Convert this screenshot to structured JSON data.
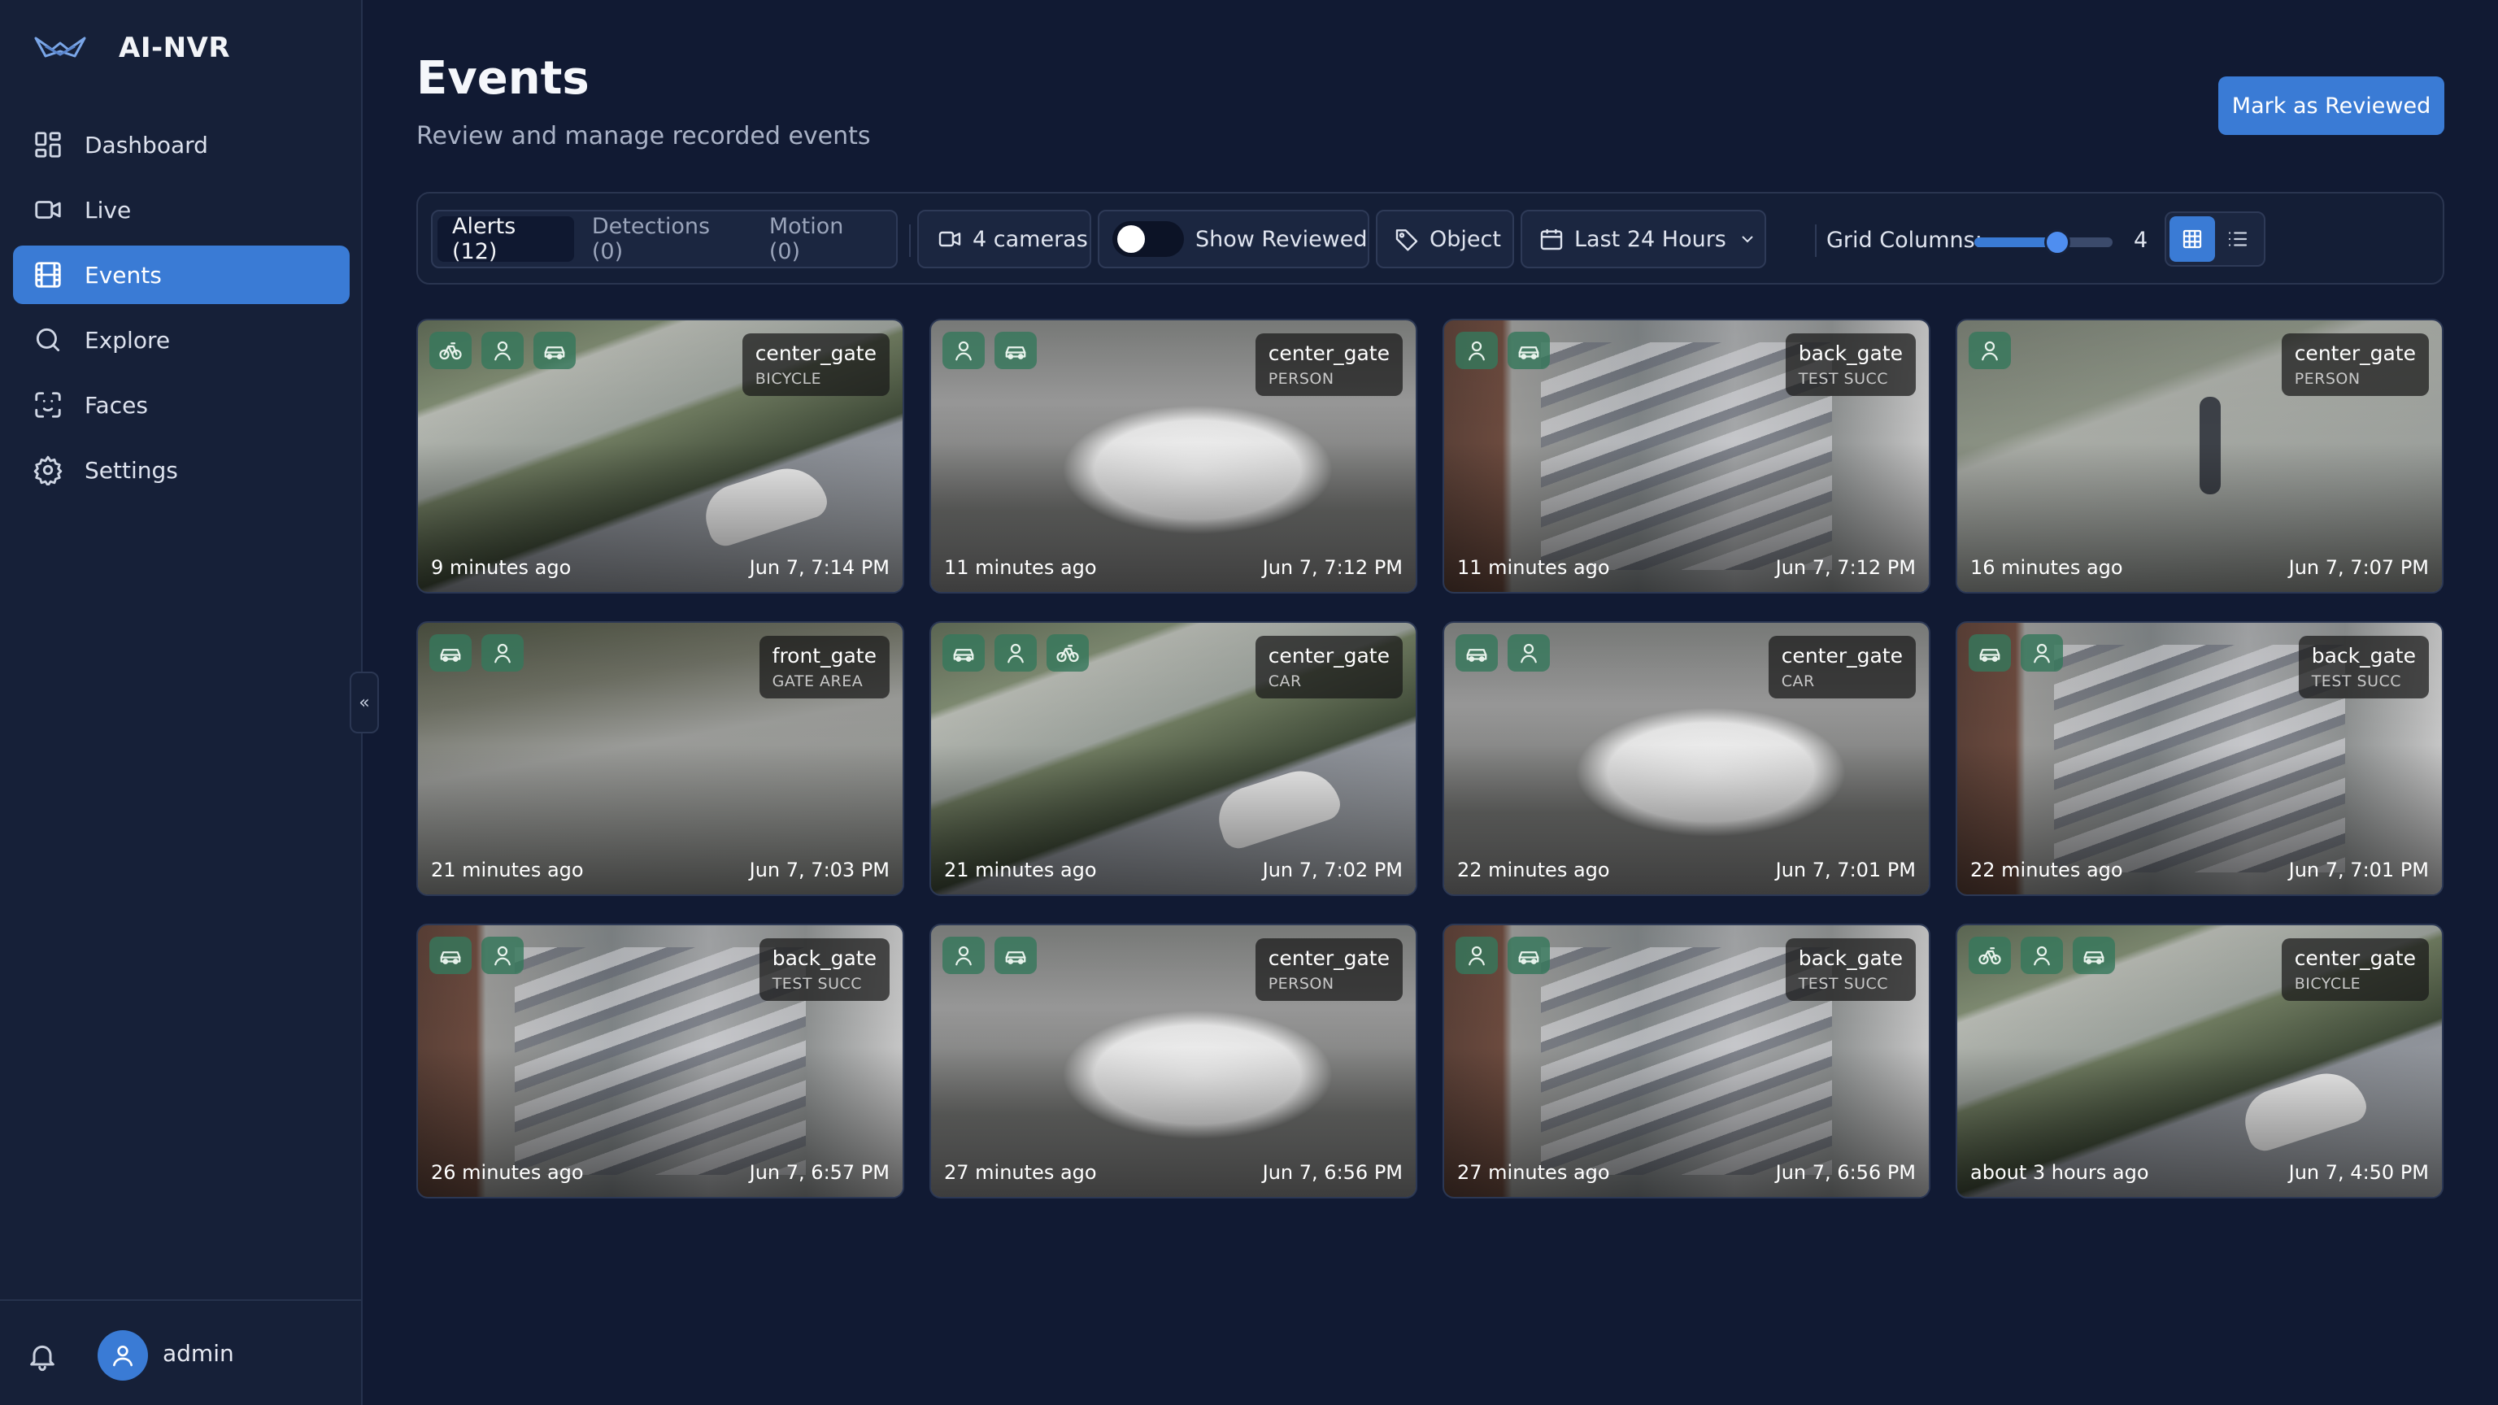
{
  "app": {
    "name": "AI-NVR"
  },
  "nav": [
    {
      "id": "dashboard",
      "label": "Dashboard",
      "icon": "dashboard-icon",
      "active": false
    },
    {
      "id": "live",
      "label": "Live",
      "icon": "video-icon",
      "active": false
    },
    {
      "id": "events",
      "label": "Events",
      "icon": "film-icon",
      "active": true
    },
    {
      "id": "explore",
      "label": "Explore",
      "icon": "search-icon",
      "active": false
    },
    {
      "id": "faces",
      "label": "Faces",
      "icon": "face-scan-icon",
      "active": false
    },
    {
      "id": "settings",
      "label": "Settings",
      "icon": "gear-icon",
      "active": false
    }
  ],
  "user": {
    "name": "admin"
  },
  "page": {
    "title": "Events",
    "subtitle": "Review and manage recorded events",
    "mark_reviewed_label": "Mark as Reviewed"
  },
  "toolbar": {
    "tabs": [
      {
        "label": "Alerts (12)",
        "active": true
      },
      {
        "label": "Detections (0)",
        "active": false
      },
      {
        "label": "Motion (0)",
        "active": false
      }
    ],
    "cameras_label": "4 cameras",
    "show_reviewed_label": "Show Reviewed",
    "show_reviewed_on": false,
    "object_label": "Object",
    "time_range_label": "Last 24 Hours",
    "grid_columns_label": "Grid Columns:",
    "grid_columns_value": "4",
    "grid_columns_min": 1,
    "grid_columns_max": 6,
    "view_mode": "grid"
  },
  "colors": {
    "accent": "#3a7bd5",
    "background": "#111a33",
    "sidebar": "#162038",
    "badge": "#36785c"
  },
  "events": [
    {
      "camera": "center_gate",
      "label": "BICYCLE",
      "ago": "9 minutes ago",
      "time": "Jun 7, 7:14 PM",
      "objects": [
        "bicycle",
        "person",
        "car"
      ],
      "scene": "road"
    },
    {
      "camera": "center_gate",
      "label": "PERSON",
      "ago": "11 minutes ago",
      "time": "Jun 7, 7:12 PM",
      "objects": [
        "person",
        "car"
      ],
      "scene": "car"
    },
    {
      "camera": "back_gate",
      "label": "TEST SUCC",
      "ago": "11 minutes ago",
      "time": "Jun 7, 7:12 PM",
      "objects": [
        "person",
        "car"
      ],
      "scene": "lot"
    },
    {
      "camera": "center_gate",
      "label": "PERSON",
      "ago": "16 minutes ago",
      "time": "Jun 7, 7:07 PM",
      "objects": [
        "person"
      ],
      "scene": "person"
    },
    {
      "camera": "front_gate",
      "label": "GATE AREA",
      "ago": "21 minutes ago",
      "time": "Jun 7, 7:03 PM",
      "objects": [
        "car",
        "person"
      ],
      "scene": "gate"
    },
    {
      "camera": "center_gate",
      "label": "CAR",
      "ago": "21 minutes ago",
      "time": "Jun 7, 7:02 PM",
      "objects": [
        "car",
        "person",
        "bicycle"
      ],
      "scene": "road"
    },
    {
      "camera": "center_gate",
      "label": "CAR",
      "ago": "22 minutes ago",
      "time": "Jun 7, 7:01 PM",
      "objects": [
        "car",
        "person"
      ],
      "scene": "car"
    },
    {
      "camera": "back_gate",
      "label": "TEST SUCC",
      "ago": "22 minutes ago",
      "time": "Jun 7, 7:01 PM",
      "objects": [
        "car",
        "person"
      ],
      "scene": "lot"
    },
    {
      "camera": "back_gate",
      "label": "TEST SUCC",
      "ago": "26 minutes ago",
      "time": "Jun 7, 6:57 PM",
      "objects": [
        "car",
        "person"
      ],
      "scene": "lot"
    },
    {
      "camera": "center_gate",
      "label": "PERSON",
      "ago": "27 minutes ago",
      "time": "Jun 7, 6:56 PM",
      "objects": [
        "person",
        "car"
      ],
      "scene": "car"
    },
    {
      "camera": "back_gate",
      "label": "TEST SUCC",
      "ago": "27 minutes ago",
      "time": "Jun 7, 6:56 PM",
      "objects": [
        "person",
        "car"
      ],
      "scene": "lot"
    },
    {
      "camera": "center_gate",
      "label": "BICYCLE",
      "ago": "about 3 hours ago",
      "time": "Jun 7, 4:50 PM",
      "objects": [
        "bicycle",
        "person",
        "car"
      ],
      "scene": "road"
    }
  ]
}
